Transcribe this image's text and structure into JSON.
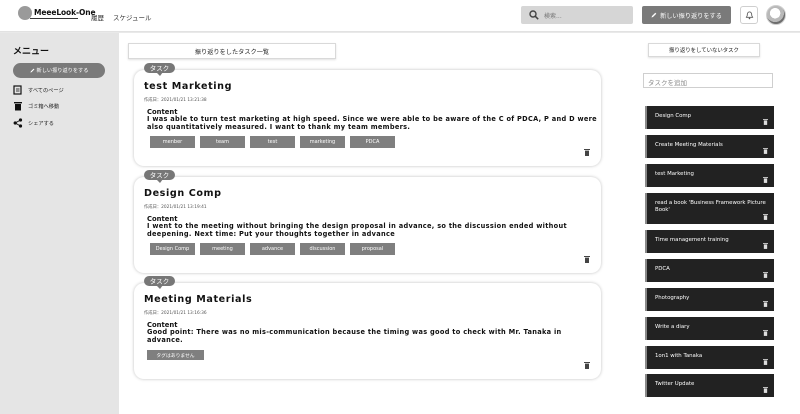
{
  "header": {
    "logo": "MeeeLook-One",
    "nav": [
      "履歴",
      "スケジュール"
    ],
    "search_placeholder": "検索...",
    "new_button": "新しい振り返りをする"
  },
  "sidebar": {
    "title": "メニュー",
    "new_button": "新しい振り返りをする",
    "items": [
      {
        "label": "すべてのページ",
        "icon": "page-icon"
      },
      {
        "label": "ゴミ箱へ移動",
        "icon": "trash-icon"
      },
      {
        "label": "シェアする",
        "icon": "share-icon"
      }
    ]
  },
  "main": {
    "list_title": "振り返りをしたタスク一覧",
    "card_badge": "タスク",
    "content_label": "Content",
    "cards": [
      {
        "title": "test Marketing",
        "date": "作成日：2021/01/21 13:21:38",
        "content": "I was able to turn test marketing at high speed. Since we were able to be aware of the C of PDCA, P and D were also quantitatively measured. I want to thank my team members.",
        "tags": [
          "menber",
          "team",
          "test",
          "marketing",
          "PDCA"
        ]
      },
      {
        "title": "Design Comp",
        "date": "作成日：2021/01/21 13:19:41",
        "content": "I went to the meeting without bringing the design proposal in advance, so the discussion ended without deepening. Next time: Put your thoughts together in advance",
        "tags": [
          "Design Comp",
          "meeting",
          "advance",
          "discussion",
          "proposal"
        ]
      },
      {
        "title": "Meeting Materials",
        "date": "作成日：2021/01/21 13:16:36",
        "content": "Good point: There was no mis-communication because the timing was good to check with Mr. Tanaka in advance.",
        "tags": [],
        "no_tags": "タグはありません"
      }
    ]
  },
  "right": {
    "title": "振り返りをしていないタスク",
    "add_placeholder": "タスクを追加",
    "tasks": [
      "Design Comp",
      "Create Meeting Materials",
      "test Marketing",
      "read a book 'Business Framework Picture Book'",
      "Time management training",
      "PDCA",
      "Photography",
      "Write a diary",
      "1on1 with Tanaka",
      "Twitter Update"
    ]
  }
}
